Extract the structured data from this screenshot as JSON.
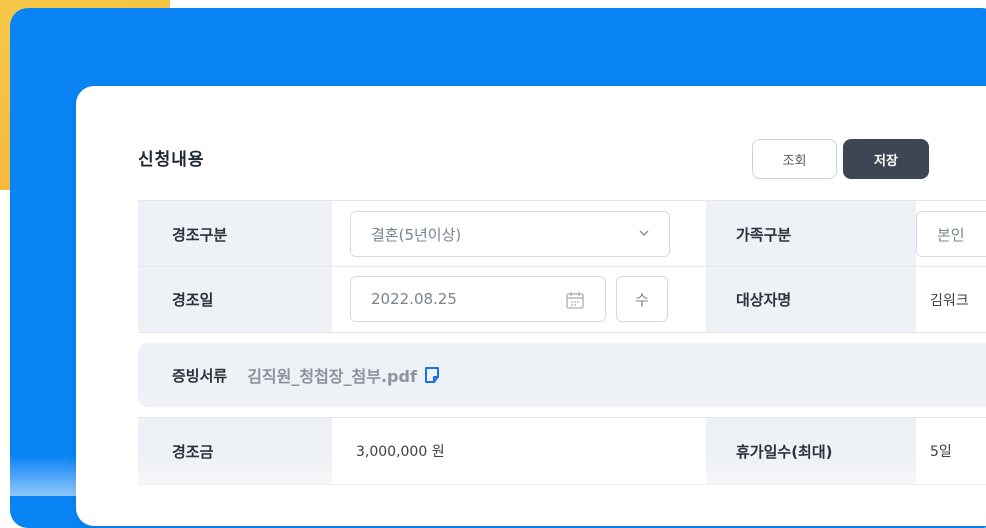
{
  "section": {
    "title": "신청내용"
  },
  "buttons": {
    "search": "조회",
    "save": "저장"
  },
  "fields": {
    "event_type": {
      "label": "경조구분",
      "value": "결혼(5년이상)"
    },
    "family_type": {
      "label": "가족구분",
      "value": "본인"
    },
    "event_date": {
      "label": "경조일",
      "value": "2022.08.25",
      "edit_label": "수"
    },
    "target_name": {
      "label": "대상자명",
      "value": "김워크"
    },
    "documents": {
      "label": "증빙서류",
      "file": "김직원_청첩장_첨부.pdf"
    },
    "amount": {
      "label": "경조금",
      "value": "3,000,000 원"
    },
    "leave_days": {
      "label": "휴가일수(최대)",
      "value": "5일"
    }
  },
  "icons": {
    "dropdown": "chevron-down-icon",
    "calendar": "calendar-icon",
    "file": "file-icon"
  },
  "colors": {
    "frame_blue": "#0a84f5",
    "accent_yellow": "#f7c948",
    "save_button": "#3e4653",
    "label_bg": "#eef1f5",
    "file_icon": "#1a73e8"
  }
}
